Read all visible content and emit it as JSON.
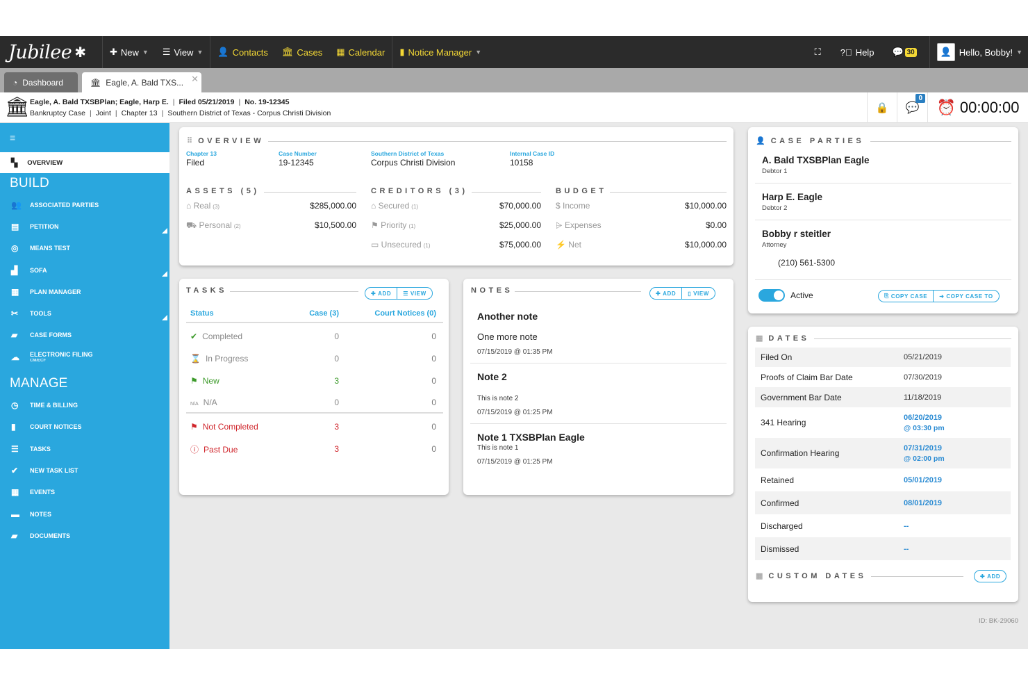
{
  "app": {
    "logo": "Jubilee",
    "nav": {
      "new": "New",
      "view": "View",
      "contacts": "Contacts",
      "cases": "Cases",
      "calendar": "Calendar",
      "notice_manager": "Notice Manager",
      "help": "Help",
      "chat_count": "30",
      "user_greeting": "Hello, Bobby!"
    },
    "colors": {
      "brand_blue": "#2aa7de",
      "topbar": "#2b2b2b",
      "nav_yellow": "#f4d835",
      "alert_red": "#d0262c"
    }
  },
  "tabs": {
    "dashboard": "Dashboard",
    "case_tab": "Eagle, A. Bald TXS..."
  },
  "case_header": {
    "parties": "Eagle, A. Bald TXSBPlan; Eagle, Harp E.",
    "filed": "Filed 05/21/2019",
    "number": "No. 19-12345",
    "type": "Bankruptcy Case",
    "joint": "Joint",
    "chapter": "Chapter 13",
    "district": "Southern District of Texas - Corpus Christi Division",
    "chat_badge": "0",
    "timer": "00:00:00"
  },
  "sidebar": {
    "active": "OVERVIEW",
    "build_heading": "BUILD",
    "build_items": [
      "Associated Parties",
      "Petition",
      "Means Test",
      "SOFA",
      "Plan Manager",
      "Tools",
      "Case Forms",
      "Electronic Filing"
    ],
    "efiling_sub": "CM/ECF",
    "manage_heading": "MANAGE",
    "manage_items": [
      "Time & Billing",
      "Court Notices",
      "Tasks",
      "New Task List",
      "Events",
      "Notes",
      "Documents"
    ]
  },
  "overview": {
    "title": "OVERVIEW",
    "chapter_label": "Chapter 13",
    "chapter_value": "Filed",
    "case_number_label": "Case Number",
    "case_number_value": "19-12345",
    "district_label": "Southern District of Texas",
    "district_value": "Corpus Christi Division",
    "internal_id_label": "Internal Case ID",
    "internal_id_value": "10158",
    "assets_title": "ASSETS (5)",
    "assets": [
      {
        "label": "Real",
        "count": "(3)",
        "amount": "$285,000.00"
      },
      {
        "label": "Personal",
        "count": "(2)",
        "amount": "$10,500.00"
      }
    ],
    "creditors_title": "CREDITORS (3)",
    "creditors": [
      {
        "label": "Secured",
        "count": "(1)",
        "amount": "$70,000.00"
      },
      {
        "label": "Priority",
        "count": "(1)",
        "amount": "$25,000.00"
      },
      {
        "label": "Unsecured",
        "count": "(1)",
        "amount": "$75,000.00"
      }
    ],
    "budget_title": "BUDGET",
    "budget": [
      {
        "label": "Income",
        "amount": "$10,000.00"
      },
      {
        "label": "Expenses",
        "amount": "$0.00"
      },
      {
        "label": "Net",
        "amount": "$10,000.00"
      }
    ]
  },
  "tasks": {
    "title": "TASKS",
    "add": "ADD",
    "view": "VIEW",
    "headers": {
      "status": "Status",
      "case": "Case (3)",
      "court": "Court Notices (0)"
    },
    "rows": [
      {
        "status": "Completed",
        "case": "0",
        "court": "0"
      },
      {
        "status": "In Progress",
        "case": "0",
        "court": "0"
      },
      {
        "status": "New",
        "case": "3",
        "court": "0"
      },
      {
        "status": "N/A",
        "case": "0",
        "court": "0"
      },
      {
        "status": "Not Completed",
        "case": "3",
        "court": "0"
      },
      {
        "status": "Past Due",
        "case": "3",
        "court": "0"
      }
    ]
  },
  "notes": {
    "title": "NOTES",
    "add": "ADD",
    "view": "VIEW",
    "items": [
      {
        "title": "Another note",
        "body": "One more note",
        "date": "07/15/2019 @ 01:35 PM"
      },
      {
        "title": "Note 2",
        "body": "This is note 2",
        "date": "07/15/2019 @ 01:25 PM"
      },
      {
        "title": "Note 1 TXSBPlan Eagle",
        "body": "This is note 1",
        "date": "07/15/2019 @ 01:25 PM"
      }
    ]
  },
  "case_parties": {
    "title": "CASE PARTIES",
    "parties": [
      {
        "name": "A. Bald TXSBPlan Eagle",
        "role": "Debtor 1"
      },
      {
        "name": "Harp E. Eagle",
        "role": "Debtor 2"
      },
      {
        "name": "Bobby r steitler",
        "role": "Attorney",
        "phone": "(210) 561-5300"
      }
    ],
    "active_label": "Active",
    "copy_case": "COPY CASE",
    "copy_case_to": "COPY CASE TO"
  },
  "dates": {
    "title": "DATES",
    "rows": [
      {
        "label": "Filed On",
        "value": "05/21/2019"
      },
      {
        "label": "Proofs of Claim Bar Date",
        "value": "07/30/2019"
      },
      {
        "label": "Government Bar Date",
        "value": "11/18/2019"
      },
      {
        "label": "341 Hearing",
        "value": "06/20/2019",
        "time": "@ 03:30 pm"
      },
      {
        "label": "Confirmation Hearing",
        "value": "07/31/2019",
        "time": "@ 02:00 pm"
      },
      {
        "label": "Retained",
        "value": "05/01/2019"
      },
      {
        "label": "Confirmed",
        "value": "08/01/2019"
      },
      {
        "label": "Discharged",
        "value": "--"
      },
      {
        "label": "Dismissed",
        "value": "--"
      }
    ],
    "custom_title": "CUSTOM DATES",
    "custom_add": "ADD"
  },
  "footer_id": "ID: BK-29060"
}
